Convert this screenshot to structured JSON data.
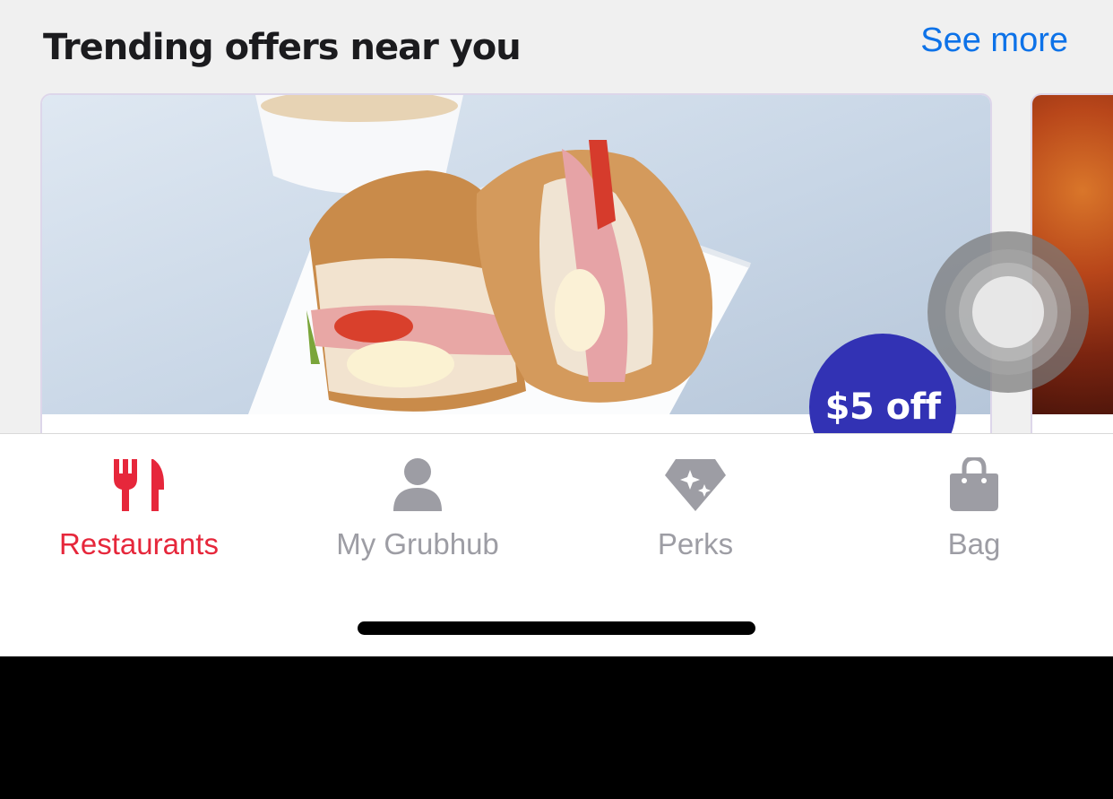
{
  "section": {
    "title": "Trending offers near you",
    "see_more_label": "See more"
  },
  "offer_card": {
    "badge_text": "$5 off"
  },
  "tab_bar": {
    "tabs": [
      {
        "label": "Restaurants",
        "icon": "fork-knife-icon",
        "active": true
      },
      {
        "label": "My Grubhub",
        "icon": "person-icon",
        "active": false
      },
      {
        "label": "Perks",
        "icon": "diamond-icon",
        "active": false
      },
      {
        "label": "Bag",
        "icon": "shopping-bag-icon",
        "active": false
      }
    ]
  },
  "colors": {
    "accent": "#e6273b",
    "link": "#0d72e8",
    "badge": "#3232b4",
    "inactive": "#9d9da4"
  }
}
